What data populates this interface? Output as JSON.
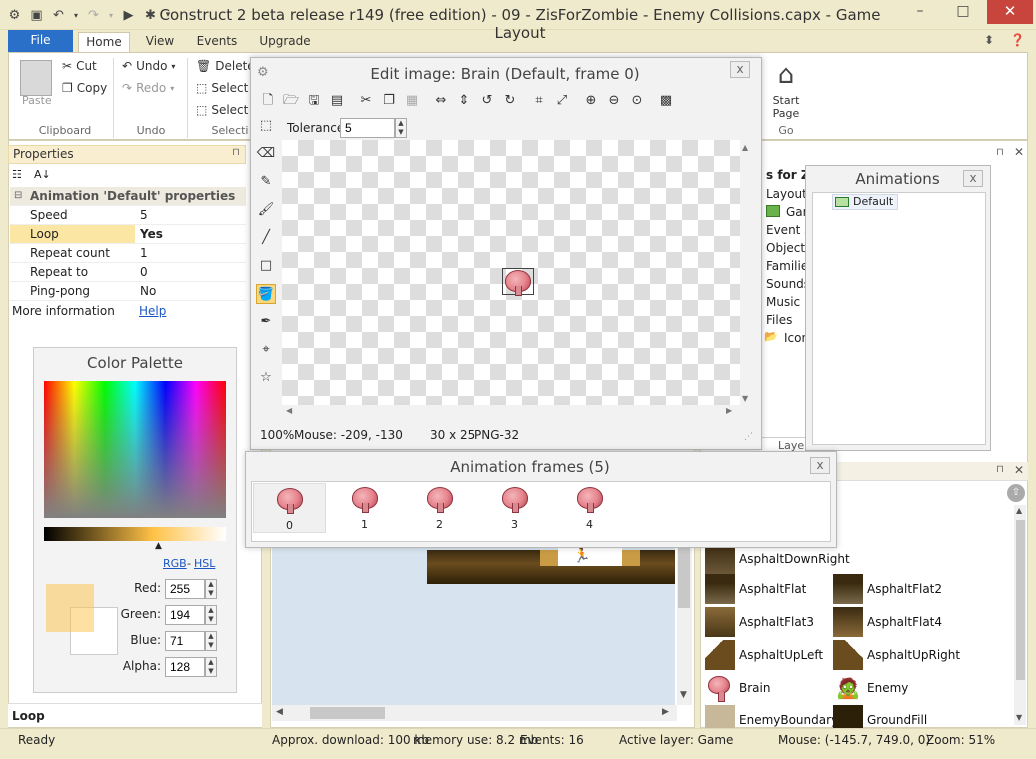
{
  "window": {
    "title": "Construct 2 beta release r149  (free edition) - 09 - ZisForZombie - Enemy Collisions.capx - Game Layout",
    "minimize": "–",
    "maximize": "□",
    "close": "✕"
  },
  "ribbon": {
    "file_tab": "File",
    "tabs": [
      "Home",
      "View",
      "Events",
      "Upgrade"
    ],
    "clipboard": {
      "paste": "Paste",
      "cut": "Cut",
      "copy": "Copy",
      "label": "Clipboard"
    },
    "undo": {
      "undo": "Undo",
      "redo": "Redo",
      "label": "Undo"
    },
    "selection": {
      "delete": "Delete",
      "select1": "Select",
      "select2": "Select",
      "label": "Selecti"
    },
    "go": {
      "start_page_l1": "Start",
      "start_page_l2": "Page",
      "label": "Go"
    }
  },
  "properties": {
    "header": "Properties",
    "pin": "⊓",
    "category": "Animation 'Default' properties",
    "rows": [
      {
        "name": "Speed",
        "value": "5"
      },
      {
        "name": "Loop",
        "value": "Yes"
      },
      {
        "name": "Repeat count",
        "value": "1"
      },
      {
        "name": "Repeat to",
        "value": "0"
      },
      {
        "name": "Ping-pong",
        "value": "No"
      }
    ],
    "more_info": "More information",
    "help_link": "Help",
    "footer": "Loop"
  },
  "color_palette": {
    "title": "Color Palette",
    "rgb": "RGB",
    "dash": "-",
    "hsl": "HSL",
    "red_label": "Red:",
    "red": "255",
    "green_label": "Green:",
    "green": "194",
    "blue_label": "Blue:",
    "blue": "71",
    "alpha_label": "Alpha:",
    "alpha": "128",
    "swatch_color": "#ffc247"
  },
  "edit_image": {
    "title": "Edit image: Brain (Default, frame 0)",
    "close": "x",
    "tolerance_label": "Tolerance",
    "tolerance": "5",
    "zoom": "100%",
    "mouse": "Mouse: -209, -130",
    "size": "30 x 25",
    "format": "PNG-32"
  },
  "animation_frames": {
    "title": "Animation frames (5)",
    "close": "x",
    "frames": [
      "0",
      "1",
      "2",
      "3",
      "4"
    ]
  },
  "animations": {
    "title": "Animations",
    "close": "x",
    "items": [
      "Default"
    ]
  },
  "project": {
    "title_partial": "s for Zo",
    "items": [
      "Layouts",
      "Gar",
      "Event s",
      "Object",
      "Familie",
      "Sounds",
      "Music",
      "Files",
      "Icon"
    ],
    "tab_partial": "Layer"
  },
  "objects": {
    "items": [
      {
        "name": "AsphaltDownRight",
        "thumb": "asphalt"
      },
      {
        "name": "AsphaltFlat",
        "thumb": "asphalt"
      },
      {
        "name": "AsphaltFlat2",
        "thumb": "asphalt"
      },
      {
        "name": "AsphaltFlat3",
        "thumb": "asphalt"
      },
      {
        "name": "AsphaltFlat4",
        "thumb": "asphalt"
      },
      {
        "name": "AsphaltUpLeft",
        "thumb": "asphalt"
      },
      {
        "name": "AsphaltUpRight",
        "thumb": "asphalt"
      },
      {
        "name": "Brain",
        "thumb": "brain"
      },
      {
        "name": "Enemy",
        "thumb": "enemy"
      },
      {
        "name": "EnemyBoundary",
        "thumb": "boundary"
      },
      {
        "name": "GroundFill",
        "thumb": "ground"
      }
    ]
  },
  "statusbar": {
    "ready": "Ready",
    "download": "Approx. download: 100 kb",
    "memory": "memory use: 8.2 mb",
    "events": "Events: 16",
    "layer": "Active layer: Game",
    "mouse": "Mouse: (-145.7, 749.0, 0)",
    "zoom": "Zoom: 51%"
  }
}
